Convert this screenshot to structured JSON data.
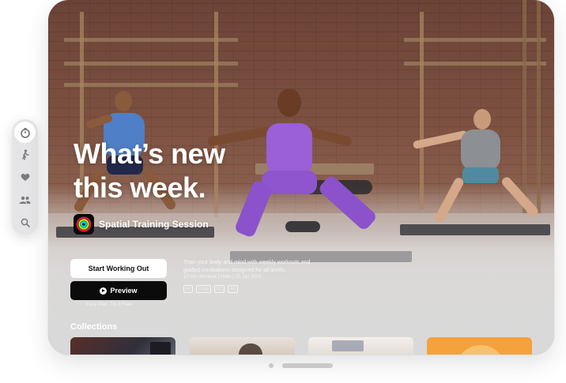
{
  "tabbar": {
    "items": [
      {
        "icon": "stopwatch-icon",
        "active": true
      },
      {
        "icon": "figure-walk-icon",
        "active": false
      },
      {
        "icon": "heart-icon",
        "active": false
      },
      {
        "icon": "people-icon",
        "active": false
      },
      {
        "icon": "search-icon",
        "active": false
      }
    ]
  },
  "hero": {
    "headline": "What’s new this week.",
    "session_title": "Spatial Training Session",
    "primary_button": "Start Working Out",
    "secondary_button": "Preview",
    "fineprint": "Easy Plan. Try it Free",
    "description": "Train your body and mind with weekly workouts and guided meditations designed for all levels.",
    "meta": "10 min Workout | Hello | 25 Jan 2024",
    "badges": [
      "4K",
      "Dolby",
      "CC",
      "AD"
    ]
  },
  "collections": {
    "label": "Collections",
    "tiles": [
      "collection-tile-1",
      "collection-tile-2",
      "collection-tile-3",
      "collection-tile-4"
    ]
  },
  "colors": {
    "accent_ring_red": "#fa114f",
    "accent_ring_green": "#a6ff00",
    "accent_ring_blue": "#00d8ff",
    "outfit_purple": "#9b5fd6",
    "tile_orange": "#f5a23c"
  }
}
